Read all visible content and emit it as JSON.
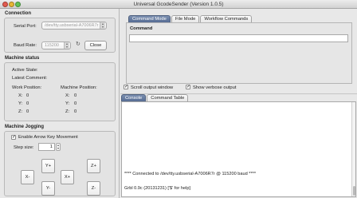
{
  "window": {
    "title": "Universal GcodeSender (Version 1.0.5)"
  },
  "connection": {
    "section_title": "Connection",
    "serial_port_label": "Serial Port:",
    "serial_port_value": "/dev/tty.usbserial-A7006R7r",
    "baud_rate_label": "Baud Rate:",
    "baud_rate_value": "115200",
    "refresh_icon": "refresh-icon",
    "close_button": "Close"
  },
  "machine_status": {
    "section_title": "Machine status",
    "active_state_label": "Active State:",
    "latest_comment_label": "Latest Comment:",
    "work_position_label": "Work Position:",
    "machine_position_label": "Machine Position:",
    "work": [
      {
        "axis": "X:",
        "value": "0"
      },
      {
        "axis": "Y:",
        "value": "0"
      },
      {
        "axis": "Z:",
        "value": "0"
      }
    ],
    "machine": [
      {
        "axis": "X:",
        "value": "0"
      },
      {
        "axis": "Y:",
        "value": "0"
      },
      {
        "axis": "Z:",
        "value": "0"
      }
    ]
  },
  "jogging": {
    "section_title": "Machine Jogging",
    "enable_arrow_label": "Enable Arrow Key Movement",
    "enable_arrow_checked": true,
    "step_size_label": "Step size:",
    "step_size_value": "1",
    "buttons": {
      "x_minus": "X-",
      "x_plus": "X+",
      "y_plus": "Y+",
      "y_minus": "Y-",
      "z_plus": "Z+",
      "z_minus": "Z-"
    }
  },
  "command_tabs": {
    "tabs": [
      "Command Mode",
      "File Mode",
      "Workflow Commands"
    ],
    "active": 0,
    "command_label": "Command",
    "command_value": ""
  },
  "options": {
    "scroll_output_label": "Scroll output window",
    "scroll_output_checked": true,
    "verbose_label": "Show verbose output",
    "verbose_checked": true
  },
  "console_tabs": {
    "tabs": [
      "Console",
      "Command Table"
    ],
    "active": 0
  },
  "console": {
    "lines": [
      "**** Connected to /dev/tty.usbserial-A7006R7r @ 115200 baud ****",
      "Grbl 0.9c (20131231) ['$' for help]"
    ]
  },
  "colors": {
    "active_tab": "#566c93",
    "window_bg": "#e8e8e8"
  }
}
